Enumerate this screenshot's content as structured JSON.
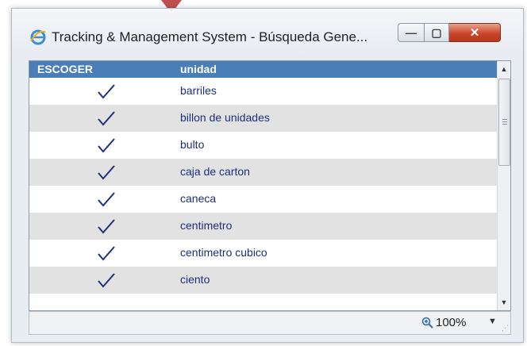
{
  "window": {
    "title": "Tracking & Management System - Búsqueda Gene...",
    "icon": "ie-browser-icon",
    "controls": {
      "minimize": "—",
      "maximize": "▢",
      "close": "✕"
    }
  },
  "grid": {
    "columns": [
      "ESCOGER",
      "unidad"
    ],
    "rows": [
      {
        "selected": true,
        "unidad": "barriles"
      },
      {
        "selected": true,
        "unidad": "billon de unidades"
      },
      {
        "selected": true,
        "unidad": "bulto"
      },
      {
        "selected": true,
        "unidad": "caja de carton"
      },
      {
        "selected": true,
        "unidad": "caneca"
      },
      {
        "selected": true,
        "unidad": "centimetro"
      },
      {
        "selected": true,
        "unidad": "centimetro cubico"
      },
      {
        "selected": true,
        "unidad": "ciento"
      }
    ]
  },
  "scrollbar": {
    "up_icon": "scroll-up-arrow-icon",
    "down_icon": "scroll-down-arrow-icon"
  },
  "statusbar": {
    "zoom": "100%",
    "zoom_icon": "zoom-icon"
  },
  "colors": {
    "header_bg": "#4a7eb6",
    "row_alt_bg": "#e2e2e2",
    "check_color": "#1f2f7a",
    "close_btn": "#c9472b"
  }
}
